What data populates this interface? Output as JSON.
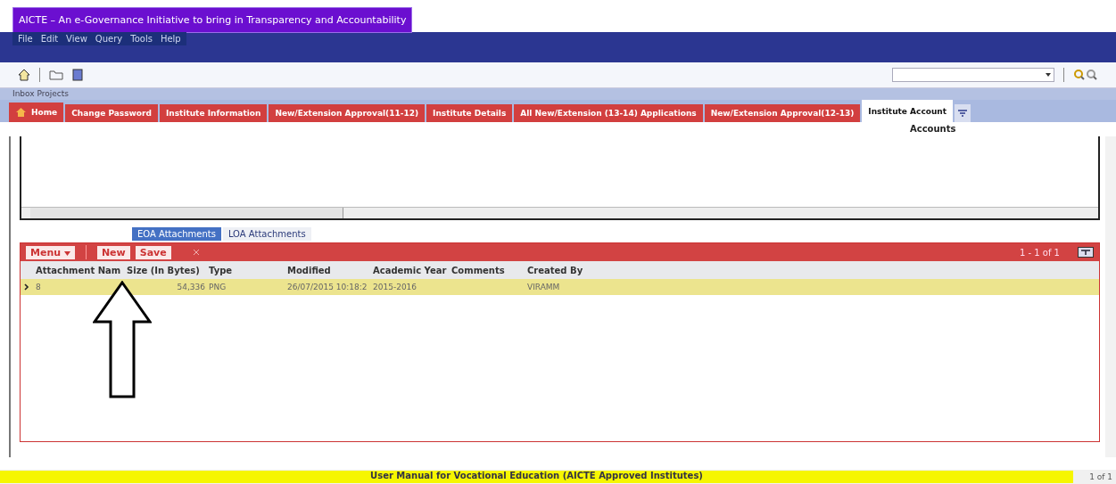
{
  "window": {
    "title": "AICTE – An e-Governance Initiative to bring in Transparency and Accountability"
  },
  "menu": [
    "File",
    "Edit",
    "View",
    "Query",
    "Tools",
    "Help"
  ],
  "breadcrumb": "Inbox Projects",
  "tabs": [
    {
      "label": "Home",
      "selected": false,
      "kind": "home"
    },
    {
      "label": "Change Password",
      "selected": false
    },
    {
      "label": "Institute Information",
      "selected": false
    },
    {
      "label": "New/Extension Approval(11-12)",
      "selected": false
    },
    {
      "label": "Institute Details",
      "selected": false
    },
    {
      "label": "All New/Extension (13-14) Applications",
      "selected": false
    },
    {
      "label": "New/Extension Approval(12-13)",
      "selected": false
    },
    {
      "label": "Institute Account",
      "selected": true
    }
  ],
  "subheading": "Accounts",
  "attachment_tabs": [
    {
      "label": "EOA Attachments",
      "selected": true
    },
    {
      "label": "LOA Attachments",
      "selected": false
    }
  ],
  "toolbar": {
    "menu": "Menu",
    "buttons": [
      "New",
      "Save"
    ],
    "pager": "1 - 1 of 1"
  },
  "table": {
    "columns": [
      "Attachment Nam",
      "Size (In Bytes)",
      "Type",
      "Modified",
      "Academic Year",
      "Comments",
      "Created By"
    ],
    "rows": [
      {
        "selected": true,
        "cells": [
          "8",
          "54,336",
          "PNG",
          "26/07/2015 10:18:2",
          "2015-2016",
          "",
          "VIRAMM"
        ]
      }
    ]
  },
  "footer": {
    "title": "User Manual for Vocational Education (AICTE Approved Institutes)",
    "pager": "1 of 1"
  }
}
